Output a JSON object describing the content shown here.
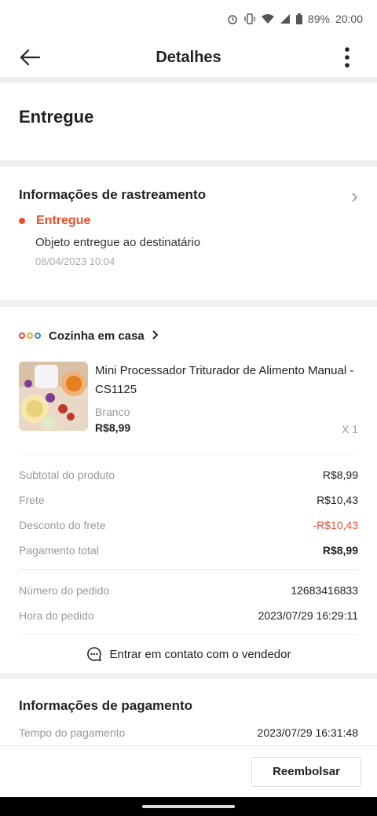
{
  "status_bar": {
    "battery": "89%",
    "time": "20:00"
  },
  "header": {
    "title": "Detalhes"
  },
  "order_status": {
    "title": "Entregue"
  },
  "tracking": {
    "title": "Informações de rastreamento",
    "status": "Entregue",
    "description": "Objeto entregue ao destinatário",
    "timestamp": "08/04/2023 10:04"
  },
  "shop": {
    "name": "Cozinha em casa",
    "logo_colors": [
      "#e8443a",
      "#f5a623",
      "#3b7ddd"
    ]
  },
  "product": {
    "name": "Mini Processador Triturador de Alimento Manual - CS1125",
    "variant": "Branco",
    "price": "R$8,99",
    "quantity": "X 1"
  },
  "summary": [
    {
      "label": "Subtotal do produto",
      "value": "R$8,99",
      "style": "normal"
    },
    {
      "label": "Frete",
      "value": "R$10,43",
      "style": "normal"
    },
    {
      "label": "Desconto do frete",
      "value": "-R$10,43",
      "style": "negative"
    },
    {
      "label": "Pagamento total",
      "value": "R$8,99",
      "style": "bold"
    }
  ],
  "order_info": [
    {
      "label": "Número do pedido",
      "value": "12683416833"
    },
    {
      "label": "Hora do pedido",
      "value": "2023/07/29 16:29:11"
    }
  ],
  "contact": {
    "label": "Entrar em contato com o vendedor"
  },
  "payment": {
    "title": "Informações de pagamento",
    "rows": [
      {
        "label": "Tempo do pagamento",
        "value": "2023/07/29 16:31:48"
      }
    ]
  },
  "actions": {
    "refund_label": "Reembolsar"
  },
  "colors": {
    "accent": "#ee4d2d"
  }
}
